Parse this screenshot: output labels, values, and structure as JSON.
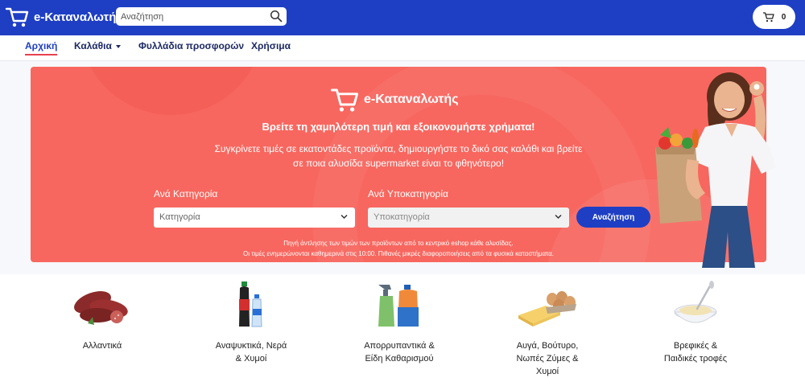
{
  "header": {
    "brand": "e-Καταναλωτής",
    "search_placeholder": "Αναζήτηση",
    "cart_count": "0",
    "colors": {
      "bar": "#1e3fc4"
    }
  },
  "nav": {
    "items": [
      {
        "label": "Αρχική",
        "active": true
      },
      {
        "label": "Καλάθια",
        "dropdown": true
      },
      {
        "label": "Φυλλάδια προσφορών"
      },
      {
        "label": "Χρήσιμα"
      }
    ]
  },
  "hero": {
    "brand": "e-Καταναλωτής",
    "title": "Βρείτε τη χαμηλότερη τιμή και εξοικονομήστε χρήματα!",
    "subtitle_line1": "Συγκρίνετε τιμές σε εκατοντάδες προϊόντα, δημιουργήστε το δικό σας καλάθι και βρείτε",
    "subtitle_line2": "σε ποια αλυσίδα supermarket είναι το φθηνότερο!",
    "category_label": "Ανά Κατηγορία",
    "category_placeholder": "Κατηγορία",
    "subcategory_label": "Ανά Υποκατηγορία",
    "subcategory_placeholder": "Υποκατηγορία",
    "search_button": "Αναζήτηση",
    "note_line1": "Πηγή άντλησης των τιμών των προϊόντων από το κεντρικό eshop κάθε αλυσίδας.",
    "note_line2": "Οι τιμές ενημερώνονται καθημερινά στις 10:00. Πιθανές μικρές διαφοροποιήσεις από τα φυσικά καταστήματα.",
    "colors": {
      "background": "#f7675f",
      "button": "#1e3fc4"
    }
  },
  "categories": [
    {
      "line1": "Αλλαντικά",
      "line2": "",
      "line3": "",
      "icon": "sausage-icon"
    },
    {
      "line1": "Αναψυκτικά, Νερά",
      "line2": "& Χυμοί",
      "line3": "",
      "icon": "bottles-icon"
    },
    {
      "line1": "Απορρυπαντικά &",
      "line2": "Είδη Καθαρισμού",
      "line3": "",
      "icon": "detergent-icon"
    },
    {
      "line1": "Αυγά, Βούτυρο,",
      "line2": "Νωπές Ζύμες &",
      "line3": "Χυμοί",
      "icon": "eggs-butter-icon"
    },
    {
      "line1": "Βρεφικές &",
      "line2": "Παιδικές τροφές",
      "line3": "",
      "icon": "baby-food-icon"
    }
  ]
}
